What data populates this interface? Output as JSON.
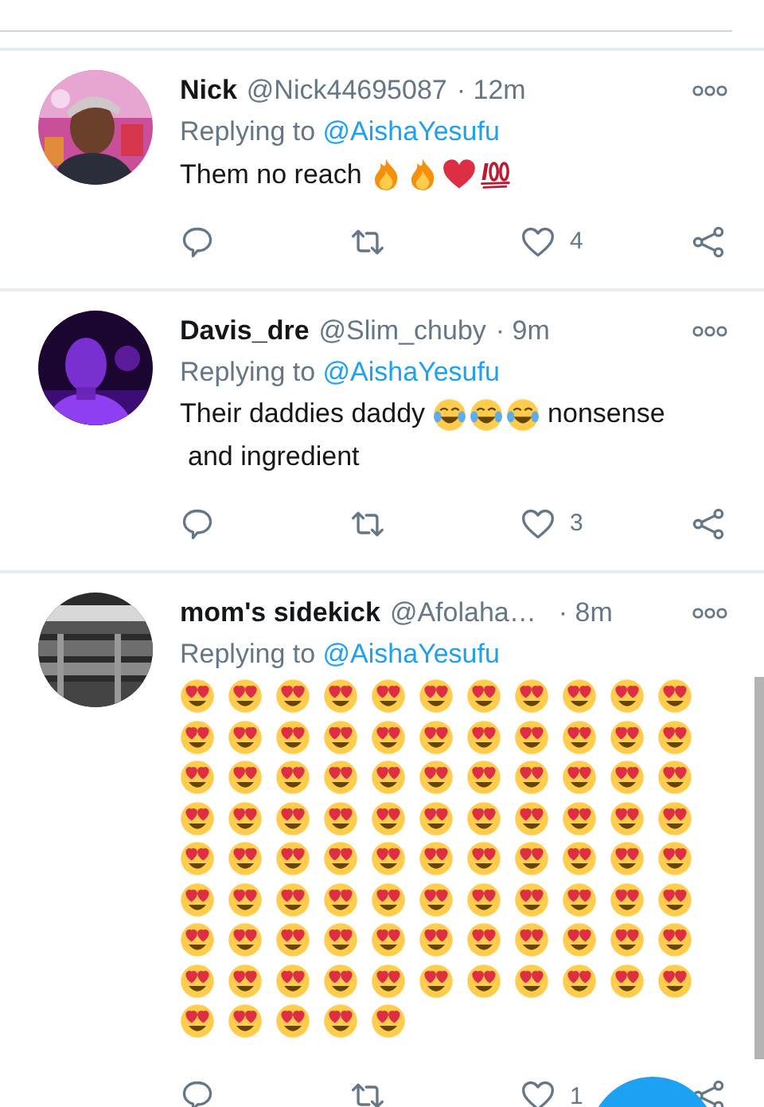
{
  "tweets": [
    {
      "name": "Nick",
      "handle": "@Nick44695087",
      "time": "· 12m",
      "replying_label": "Replying to",
      "reply_to": "@AishaYesufu",
      "body": [
        {
          "kind": "text",
          "text": "Them no reach"
        },
        {
          "kind": "fire"
        },
        {
          "kind": "fire"
        },
        {
          "kind": "heart"
        },
        {
          "kind": "hundred"
        }
      ],
      "likes": "4"
    },
    {
      "name": "Davis_dre",
      "handle": "@Slim_chuby",
      "time": "· 9m",
      "replying_label": "Replying to",
      "reply_to": "@AishaYesufu",
      "body": [
        {
          "kind": "text",
          "text": "Their daddies daddy"
        },
        {
          "kind": "joy"
        },
        {
          "kind": "joy"
        },
        {
          "kind": "joy"
        },
        {
          "kind": "text",
          "text": "nonsense"
        },
        {
          "kind": "text",
          "text": "and ingredient"
        }
      ],
      "likes": "3"
    },
    {
      "name": "mom's sidekick",
      "handle": "@Afolaha…",
      "time": "· 8m",
      "replying_label": "Replying to",
      "reply_to": "@AishaYesufu",
      "body": [
        {
          "kind": "heart_eyes"
        },
        {
          "kind": "heart_eyes"
        },
        {
          "kind": "heart_eyes"
        },
        {
          "kind": "heart_eyes"
        },
        {
          "kind": "heart_eyes"
        },
        {
          "kind": "heart_eyes"
        },
        {
          "kind": "heart_eyes"
        },
        {
          "kind": "heart_eyes"
        },
        {
          "kind": "heart_eyes"
        },
        {
          "kind": "heart_eyes"
        },
        {
          "kind": "heart_eyes"
        },
        {
          "kind": "heart_eyes"
        },
        {
          "kind": "heart_eyes"
        },
        {
          "kind": "heart_eyes"
        },
        {
          "kind": "heart_eyes"
        },
        {
          "kind": "heart_eyes"
        },
        {
          "kind": "heart_eyes"
        },
        {
          "kind": "heart_eyes"
        },
        {
          "kind": "heart_eyes"
        },
        {
          "kind": "heart_eyes"
        },
        {
          "kind": "heart_eyes"
        },
        {
          "kind": "heart_eyes"
        },
        {
          "kind": "heart_eyes"
        },
        {
          "kind": "heart_eyes"
        },
        {
          "kind": "heart_eyes"
        },
        {
          "kind": "heart_eyes"
        },
        {
          "kind": "heart_eyes"
        },
        {
          "kind": "heart_eyes"
        },
        {
          "kind": "heart_eyes"
        },
        {
          "kind": "heart_eyes"
        },
        {
          "kind": "heart_eyes"
        },
        {
          "kind": "heart_eyes"
        },
        {
          "kind": "heart_eyes"
        },
        {
          "kind": "heart_eyes"
        },
        {
          "kind": "heart_eyes"
        },
        {
          "kind": "heart_eyes"
        },
        {
          "kind": "heart_eyes"
        },
        {
          "kind": "heart_eyes"
        },
        {
          "kind": "heart_eyes"
        },
        {
          "kind": "heart_eyes"
        },
        {
          "kind": "heart_eyes"
        },
        {
          "kind": "heart_eyes"
        },
        {
          "kind": "heart_eyes"
        },
        {
          "kind": "heart_eyes"
        },
        {
          "kind": "heart_eyes"
        },
        {
          "kind": "heart_eyes"
        },
        {
          "kind": "heart_eyes"
        },
        {
          "kind": "heart_eyes"
        },
        {
          "kind": "heart_eyes"
        },
        {
          "kind": "heart_eyes"
        },
        {
          "kind": "heart_eyes"
        },
        {
          "kind": "heart_eyes"
        },
        {
          "kind": "heart_eyes"
        },
        {
          "kind": "heart_eyes"
        },
        {
          "kind": "heart_eyes"
        },
        {
          "kind": "heart_eyes"
        },
        {
          "kind": "heart_eyes"
        },
        {
          "kind": "heart_eyes"
        },
        {
          "kind": "heart_eyes"
        },
        {
          "kind": "heart_eyes"
        },
        {
          "kind": "heart_eyes"
        },
        {
          "kind": "heart_eyes"
        },
        {
          "kind": "heart_eyes"
        },
        {
          "kind": "heart_eyes"
        },
        {
          "kind": "heart_eyes"
        },
        {
          "kind": "heart_eyes"
        },
        {
          "kind": "heart_eyes"
        },
        {
          "kind": "heart_eyes"
        },
        {
          "kind": "heart_eyes"
        },
        {
          "kind": "heart_eyes"
        },
        {
          "kind": "heart_eyes"
        },
        {
          "kind": "heart_eyes"
        },
        {
          "kind": "heart_eyes"
        },
        {
          "kind": "heart_eyes"
        },
        {
          "kind": "heart_eyes"
        },
        {
          "kind": "heart_eyes"
        },
        {
          "kind": "heart_eyes"
        },
        {
          "kind": "heart_eyes"
        },
        {
          "kind": "heart_eyes"
        },
        {
          "kind": "heart_eyes"
        },
        {
          "kind": "heart_eyes"
        },
        {
          "kind": "heart_eyes"
        },
        {
          "kind": "heart_eyes"
        },
        {
          "kind": "heart_eyes"
        },
        {
          "kind": "heart_eyes"
        },
        {
          "kind": "heart_eyes"
        },
        {
          "kind": "heart_eyes"
        },
        {
          "kind": "heart_eyes"
        },
        {
          "kind": "heart_eyes"
        },
        {
          "kind": "heart_eyes"
        },
        {
          "kind": "heart_eyes"
        },
        {
          "kind": "heart_eyes"
        },
        {
          "kind": "heart_eyes"
        }
      ],
      "likes": "1"
    }
  ]
}
